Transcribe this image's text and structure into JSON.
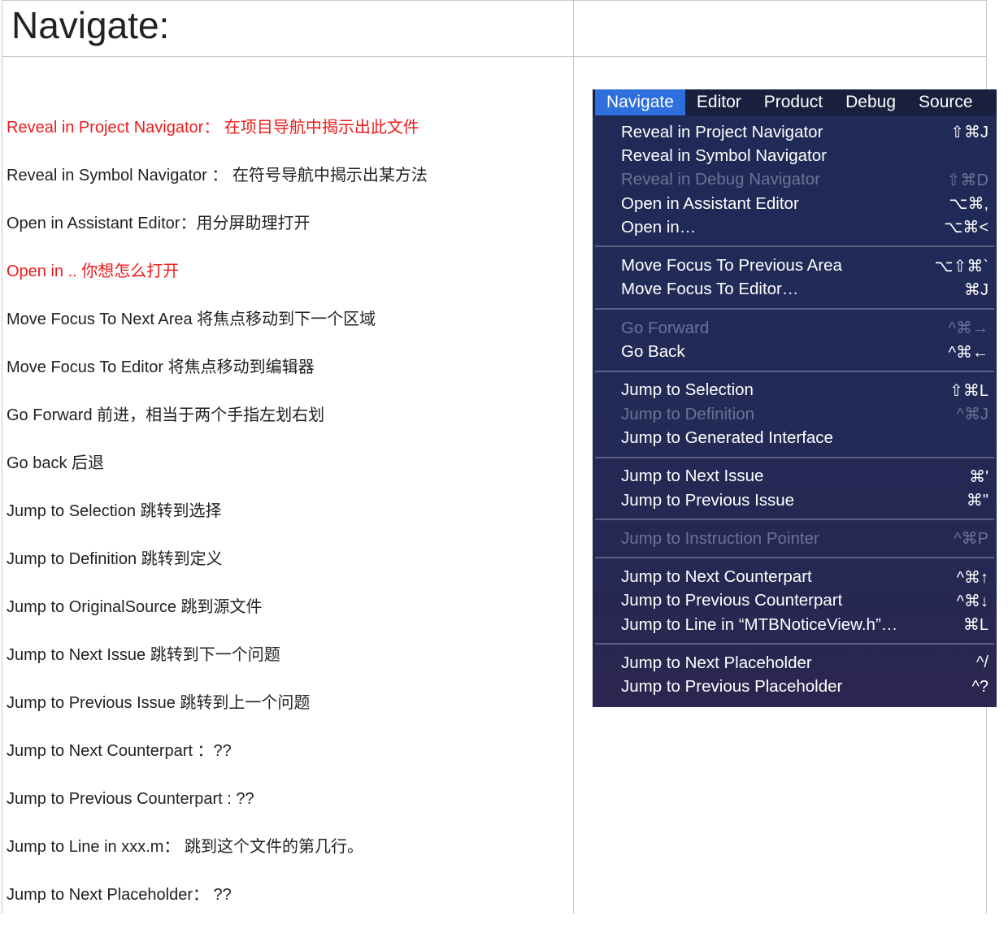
{
  "heading": "Navigate:",
  "notes": [
    {
      "text": "Reveal in Project Navigator： 在项目导航中揭示出此文件",
      "red": true
    },
    {
      "text": "Reveal in Symbol Navigator  ： 在符号导航中揭示出某方法",
      "red": false
    },
    {
      "text": "Open in Assistant Editor：用分屏助理打开",
      "red": false
    },
    {
      "text": "Open in ..  你想怎么打开",
      "red": true
    },
    {
      "text": "Move Focus To Next Area  将焦点移动到下一个区域",
      "red": false
    },
    {
      "text": "Move Focus To Editor   将焦点移动到编辑器",
      "red": false
    },
    {
      "text": "Go Forward  前进，相当于两个手指左划右划",
      "red": false
    },
    {
      "text": "Go back  后退",
      "red": false
    },
    {
      "text": "Jump to Selection 跳转到选择",
      "red": false
    },
    {
      "text": "Jump to Definition 跳转到定义",
      "red": false
    },
    {
      "text": "Jump to OriginalSource 跳到源文件",
      "red": false
    },
    {
      "text": "Jump to Next Issue  跳转到下一个问题",
      "red": false
    },
    {
      "text": "Jump to Previous Issue  跳转到上一个问题",
      "red": false
    },
    {
      "text": "Jump to Next Counterpart  ：??",
      "red": false
    },
    {
      "text": "Jump to Previous Counterpart : ??",
      "red": false
    },
    {
      "text": "Jump to Line in xxx.m：  跳到这个文件的第几行。",
      "red": false
    },
    {
      "text": "Jump to Next Placeholder：  ??",
      "red": false
    }
  ],
  "menubar": [
    "Navigate",
    "Editor",
    "Product",
    "Debug",
    "Source"
  ],
  "menu": {
    "groups": [
      [
        {
          "label": "Reveal in Project Navigator",
          "shortcut": "⇧⌘J",
          "disabled": false
        },
        {
          "label": "Reveal in Symbol Navigator",
          "shortcut": "",
          "disabled": false
        },
        {
          "label": "Reveal in Debug Navigator",
          "shortcut": "⇧⌘D",
          "disabled": true
        },
        {
          "label": "Open in Assistant Editor",
          "shortcut": "⌥⌘,",
          "disabled": false
        },
        {
          "label": "Open in…",
          "shortcut": "⌥⌘<",
          "disabled": false
        }
      ],
      [
        {
          "label": "Move Focus To Previous Area",
          "shortcut": "⌥⇧⌘`",
          "disabled": false
        },
        {
          "label": "Move Focus To Editor…",
          "shortcut": "⌘J",
          "disabled": false
        }
      ],
      [
        {
          "label": "Go Forward",
          "shortcut": "^⌘→",
          "disabled": true
        },
        {
          "label": "Go Back",
          "shortcut": "^⌘←",
          "disabled": false
        }
      ],
      [
        {
          "label": "Jump to Selection",
          "shortcut": "⇧⌘L",
          "disabled": false
        },
        {
          "label": "Jump to Definition",
          "shortcut": "^⌘J",
          "disabled": true
        },
        {
          "label": "Jump to Generated Interface",
          "shortcut": "",
          "disabled": false
        }
      ],
      [
        {
          "label": "Jump to Next Issue",
          "shortcut": "⌘'",
          "disabled": false
        },
        {
          "label": "Jump to Previous Issue",
          "shortcut": "⌘\"",
          "disabled": false
        }
      ],
      [
        {
          "label": "Jump to Instruction Pointer",
          "shortcut": "^⌘P",
          "disabled": true
        }
      ],
      [
        {
          "label": "Jump to Next Counterpart",
          "shortcut": "^⌘↑",
          "disabled": false
        },
        {
          "label": "Jump to Previous Counterpart",
          "shortcut": "^⌘↓",
          "disabled": false
        },
        {
          "label": "Jump to Line in “MTBNoticeView.h”…",
          "shortcut": "⌘L",
          "disabled": false
        }
      ],
      [
        {
          "label": "Jump to Next Placeholder",
          "shortcut": "^/",
          "disabled": false
        },
        {
          "label": "Jump to Previous Placeholder",
          "shortcut": "^?",
          "disabled": false
        }
      ]
    ]
  }
}
